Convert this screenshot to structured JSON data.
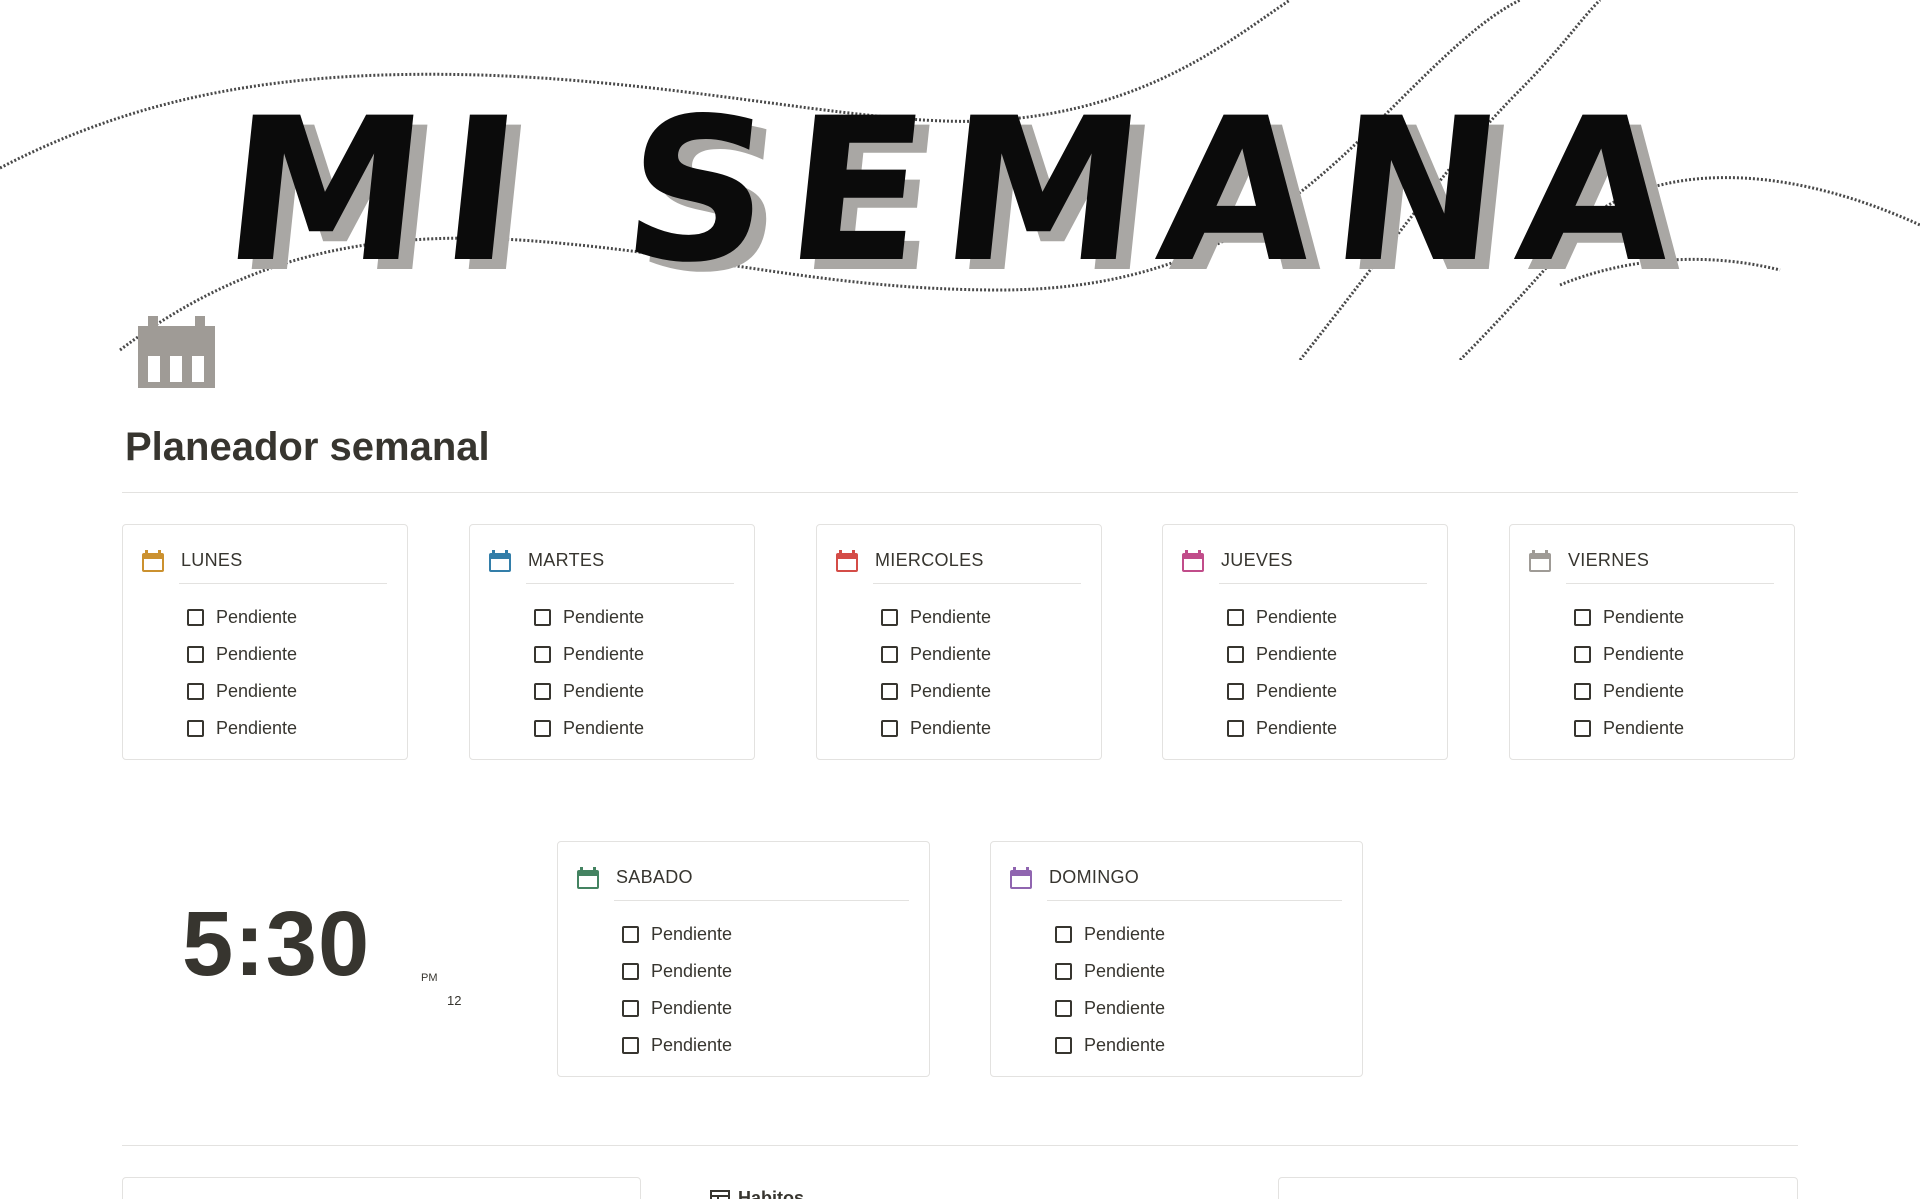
{
  "cover": {
    "title": "MI SEMANA"
  },
  "page": {
    "title": "Planeador semanal",
    "icon": "calendar-icon"
  },
  "days_row1": [
    {
      "name": "LUNES",
      "color": "#cb912f",
      "tasks": [
        "Pendiente",
        "Pendiente",
        "Pendiente",
        "Pendiente"
      ]
    },
    {
      "name": "MARTES",
      "color": "#337ea9",
      "tasks": [
        "Pendiente",
        "Pendiente",
        "Pendiente",
        "Pendiente"
      ]
    },
    {
      "name": "MIERCOLES",
      "color": "#d44c47",
      "tasks": [
        "Pendiente",
        "Pendiente",
        "Pendiente",
        "Pendiente"
      ]
    },
    {
      "name": "JUEVES",
      "color": "#c14c8a",
      "tasks": [
        "Pendiente",
        "Pendiente",
        "Pendiente",
        "Pendiente"
      ]
    },
    {
      "name": "VIERNES",
      "color": "#9f9b96",
      "tasks": [
        "Pendiente",
        "Pendiente",
        "Pendiente",
        "Pendiente"
      ]
    }
  ],
  "days_row2": [
    {
      "name": "SABADO",
      "color": "#448361",
      "tasks": [
        "Pendiente",
        "Pendiente",
        "Pendiente",
        "Pendiente"
      ]
    },
    {
      "name": "DOMINGO",
      "color": "#9065b0",
      "tasks": [
        "Pendiente",
        "Pendiente",
        "Pendiente",
        "Pendiente"
      ]
    }
  ],
  "clock": {
    "time": "5:30",
    "ampm": "PM",
    "format": "12"
  },
  "bottom": {
    "habits_label": "Habitos"
  }
}
